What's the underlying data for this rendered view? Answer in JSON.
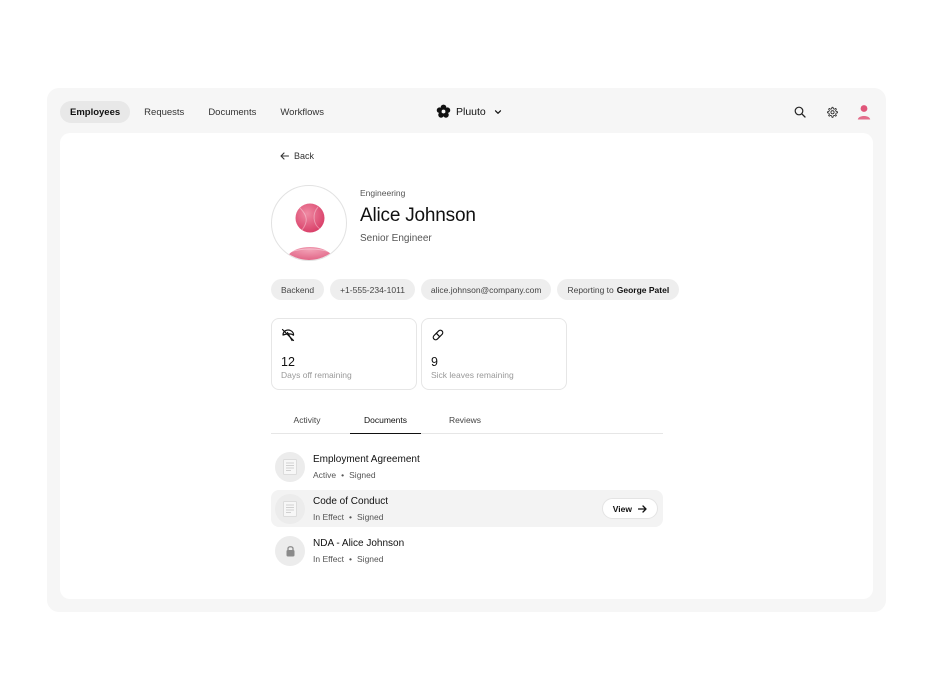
{
  "nav": {
    "tabs": [
      {
        "label": "Employees",
        "active": true
      },
      {
        "label": "Requests",
        "active": false
      },
      {
        "label": "Documents",
        "active": false
      },
      {
        "label": "Workflows",
        "active": false
      }
    ],
    "brand": "Pluuto"
  },
  "profile": {
    "back_label": "Back",
    "department": "Engineering",
    "name": "Alice Johnson",
    "role": "Senior Engineer",
    "chips": {
      "team": "Backend",
      "phone": "+1-555-234-1011",
      "email": "alice.johnson@company.com",
      "reporting_prefix": "Reporting to",
      "manager": "George Patel"
    }
  },
  "stats": [
    {
      "icon": "beach-umbrella-icon",
      "value": "12",
      "label": "Days off remaining"
    },
    {
      "icon": "pill-icon",
      "value": "9",
      "label": "Sick leaves remaining"
    }
  ],
  "tabs": [
    {
      "label": "Activity",
      "active": false
    },
    {
      "label": "Documents",
      "active": true
    },
    {
      "label": "Reviews",
      "active": false
    }
  ],
  "documents": [
    {
      "title": "Employment Agreement",
      "status": "Active",
      "state": "Signed",
      "icon": "document-thumbnail"
    },
    {
      "title": "Code of Conduct",
      "status": "In Effect",
      "state": "Signed",
      "icon": "document-thumbnail"
    },
    {
      "title": "NDA - Alice Johnson",
      "status": "In Effect",
      "state": "Signed",
      "icon": "lock-icon"
    }
  ],
  "view_button": "View",
  "colors": {
    "background": "#f6f6f6",
    "panel": "#ffffff",
    "chip": "#eeeeee",
    "avatar_accent": "#e0567a"
  }
}
